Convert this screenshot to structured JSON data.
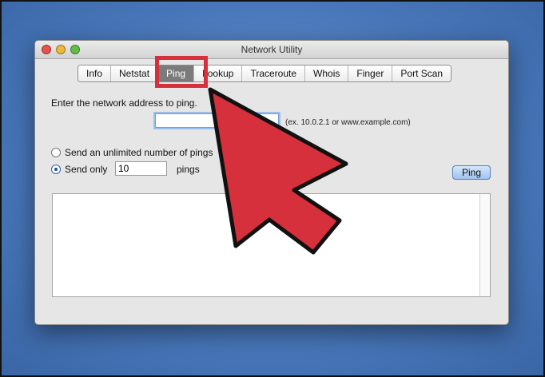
{
  "window": {
    "title": "Network Utility"
  },
  "tabs": [
    {
      "label": "Info"
    },
    {
      "label": "Netstat"
    },
    {
      "label": "Ping",
      "active": true
    },
    {
      "label": "Lookup"
    },
    {
      "label": "Traceroute"
    },
    {
      "label": "Whois"
    },
    {
      "label": "Finger"
    },
    {
      "label": "Port Scan"
    }
  ],
  "ping": {
    "address_label": "Enter the network address to ping.",
    "address_value": "",
    "address_hint": "(ex. 10.0.2.1 or www.example.com)",
    "unlimited_label": "Send an unlimited number of pings",
    "send_only_label": "Send only",
    "count_value": "10",
    "pings_suffix": "pings",
    "button_label": "Ping"
  },
  "colors": {
    "background": "#4b7bbf",
    "highlight": "#d6303c",
    "button": "#a9c9f0"
  },
  "icons": [
    "close-icon",
    "minimize-icon",
    "zoom-icon",
    "cursor-arrow-icon"
  ]
}
